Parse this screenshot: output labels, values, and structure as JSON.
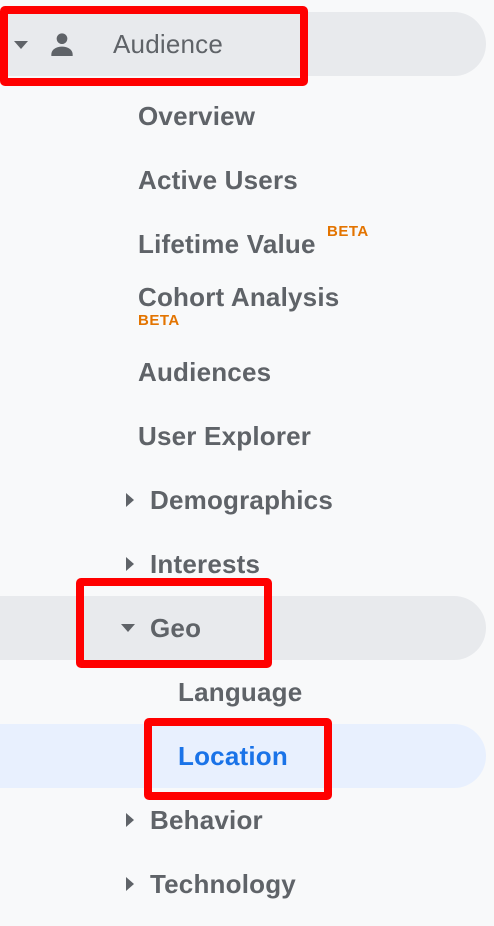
{
  "nav": {
    "audience": {
      "label": "Audience",
      "icon": "person-icon"
    },
    "items": {
      "overview": "Overview",
      "active_users": "Active Users",
      "lifetime_value": "Lifetime Value",
      "cohort_analysis": "Cohort Analysis",
      "audiences": "Audiences",
      "user_explorer": "User Explorer",
      "demographics": "Demographics",
      "interests": "Interests",
      "geo": "Geo",
      "language": "Language",
      "location": "Location",
      "behavior": "Behavior",
      "technology": "Technology"
    },
    "beta_badge": "BETA",
    "active_item": "Location"
  },
  "colors": {
    "text": "#5f6368",
    "active_text": "#1a73e8",
    "beta": "#e37400",
    "hover_bg": "#e8eaed",
    "active_bg": "#e8f0fe",
    "highlight_box": "#ff0000"
  }
}
